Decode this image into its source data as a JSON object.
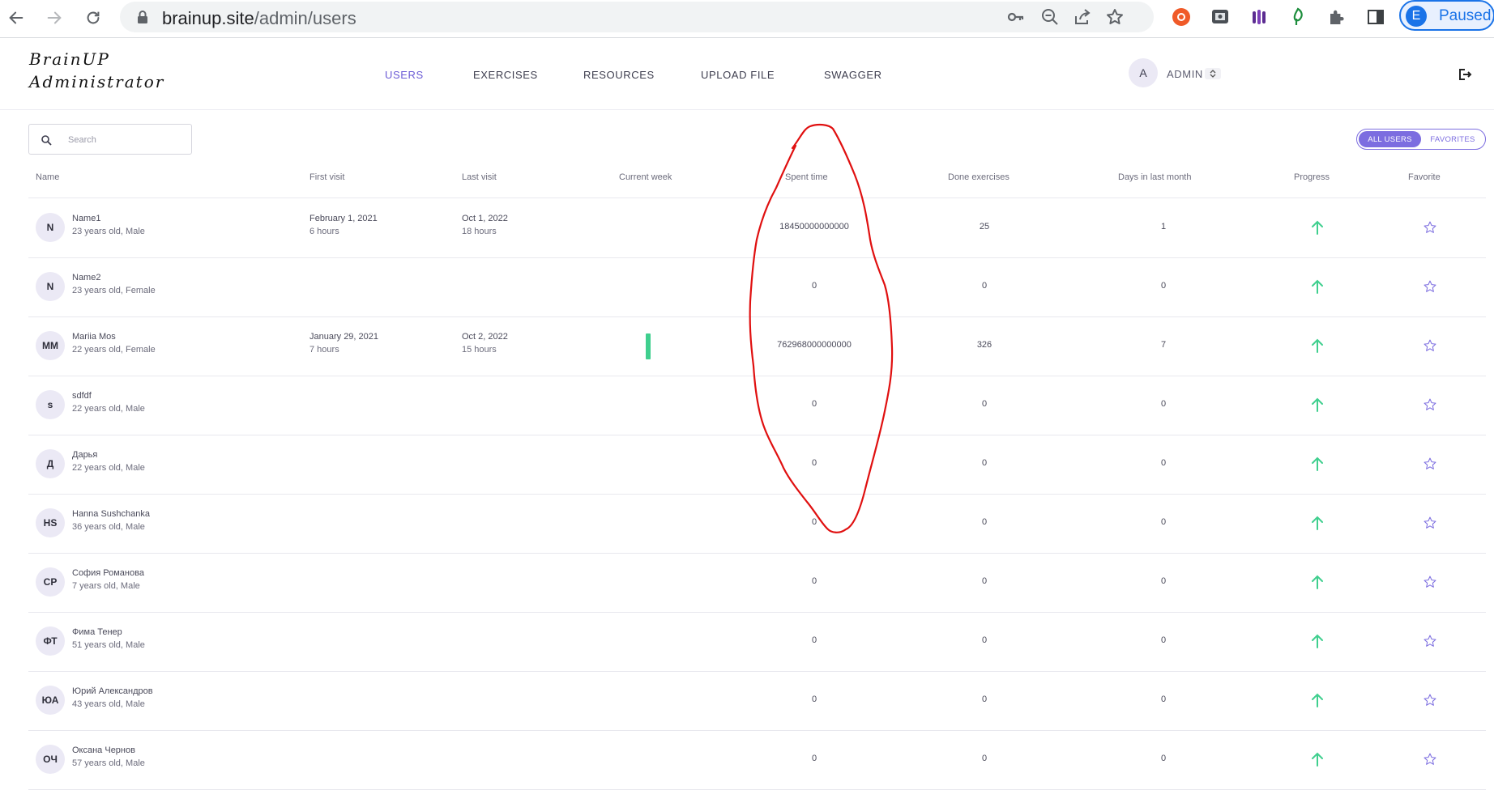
{
  "browser": {
    "url_host": "brainup.site",
    "url_path": "/admin/users",
    "profile_initial": "E",
    "profile_status": "Paused"
  },
  "header": {
    "logo_line1": "BrainUP",
    "logo_line2": "Administrator",
    "nav": [
      "USERS",
      "EXERCISES",
      "RESOURCES",
      "UPLOAD FILE",
      "SWAGGER"
    ],
    "active_nav": "USERS",
    "admin_initial": "A",
    "admin_label": "ADMIN"
  },
  "toolbar": {
    "search_placeholder": "Search",
    "filter_all": "ALL USERS",
    "filter_favorites": "FAVORITES",
    "active_filter": "ALL USERS"
  },
  "table": {
    "columns": [
      "Name",
      "First visit",
      "Last visit",
      "Current week",
      "Spent time",
      "Done exercises",
      "Days in last month",
      "Progress",
      "Favorite"
    ],
    "rows": [
      {
        "initials": "N",
        "name": "Name1",
        "meta": "23 years old, Male",
        "first_visit": "February 1, 2021",
        "first_visit_hours": "6 hours",
        "last_visit": "Oct 1, 2022",
        "last_visit_hours": "18 hours",
        "week_activity": false,
        "spent_time": "18450000000000",
        "done_exercises": "25",
        "days_last_month": "1"
      },
      {
        "initials": "N",
        "name": "Name2",
        "meta": "23 years old, Female",
        "first_visit": "",
        "first_visit_hours": "",
        "last_visit": "",
        "last_visit_hours": "",
        "week_activity": false,
        "spent_time": "0",
        "done_exercises": "0",
        "days_last_month": "0"
      },
      {
        "initials": "MM",
        "name": "Mariia Mos",
        "meta": "22 years old, Female",
        "first_visit": "January 29, 2021",
        "first_visit_hours": "7 hours",
        "last_visit": "Oct 2, 2022",
        "last_visit_hours": "15 hours",
        "week_activity": true,
        "spent_time": "762968000000000",
        "done_exercises": "326",
        "days_last_month": "7"
      },
      {
        "initials": "s",
        "name": "sdfdf",
        "meta": "22 years old, Male",
        "first_visit": "",
        "first_visit_hours": "",
        "last_visit": "",
        "last_visit_hours": "",
        "week_activity": false,
        "spent_time": "0",
        "done_exercises": "0",
        "days_last_month": "0"
      },
      {
        "initials": "Д",
        "name": "Дарья",
        "meta": "22 years old, Male",
        "first_visit": "",
        "first_visit_hours": "",
        "last_visit": "",
        "last_visit_hours": "",
        "week_activity": false,
        "spent_time": "0",
        "done_exercises": "0",
        "days_last_month": "0"
      },
      {
        "initials": "HS",
        "name": "Hanna Sushchanka",
        "meta": "36 years old, Male",
        "first_visit": "",
        "first_visit_hours": "",
        "last_visit": "",
        "last_visit_hours": "",
        "week_activity": false,
        "spent_time": "0",
        "done_exercises": "0",
        "days_last_month": "0"
      },
      {
        "initials": "СР",
        "name": "София Романова",
        "meta": "7 years old, Male",
        "first_visit": "",
        "first_visit_hours": "",
        "last_visit": "",
        "last_visit_hours": "",
        "week_activity": false,
        "spent_time": "0",
        "done_exercises": "0",
        "days_last_month": "0"
      },
      {
        "initials": "ФТ",
        "name": "Фима Тенер",
        "meta": "51 years old, Male",
        "first_visit": "",
        "first_visit_hours": "",
        "last_visit": "",
        "last_visit_hours": "",
        "week_activity": false,
        "spent_time": "0",
        "done_exercises": "0",
        "days_last_month": "0"
      },
      {
        "initials": "ЮА",
        "name": "Юрий Александров",
        "meta": "43 years old, Male",
        "first_visit": "",
        "first_visit_hours": "",
        "last_visit": "",
        "last_visit_hours": "",
        "week_activity": false,
        "spent_time": "0",
        "done_exercises": "0",
        "days_last_month": "0"
      },
      {
        "initials": "ОЧ",
        "name": "Оксана Чернов",
        "meta": "57 years old, Male",
        "first_visit": "",
        "first_visit_hours": "",
        "last_visit": "",
        "last_visit_hours": "",
        "week_activity": false,
        "spent_time": "0",
        "done_exercises": "0",
        "days_last_month": "0"
      }
    ]
  },
  "icons": {
    "progress": "arrow-up-icon",
    "favorite": "star-outline-icon"
  },
  "colors": {
    "accent": "#7c6de0",
    "progress_green": "#3fcf8e",
    "annotation_red": "#e01010"
  }
}
